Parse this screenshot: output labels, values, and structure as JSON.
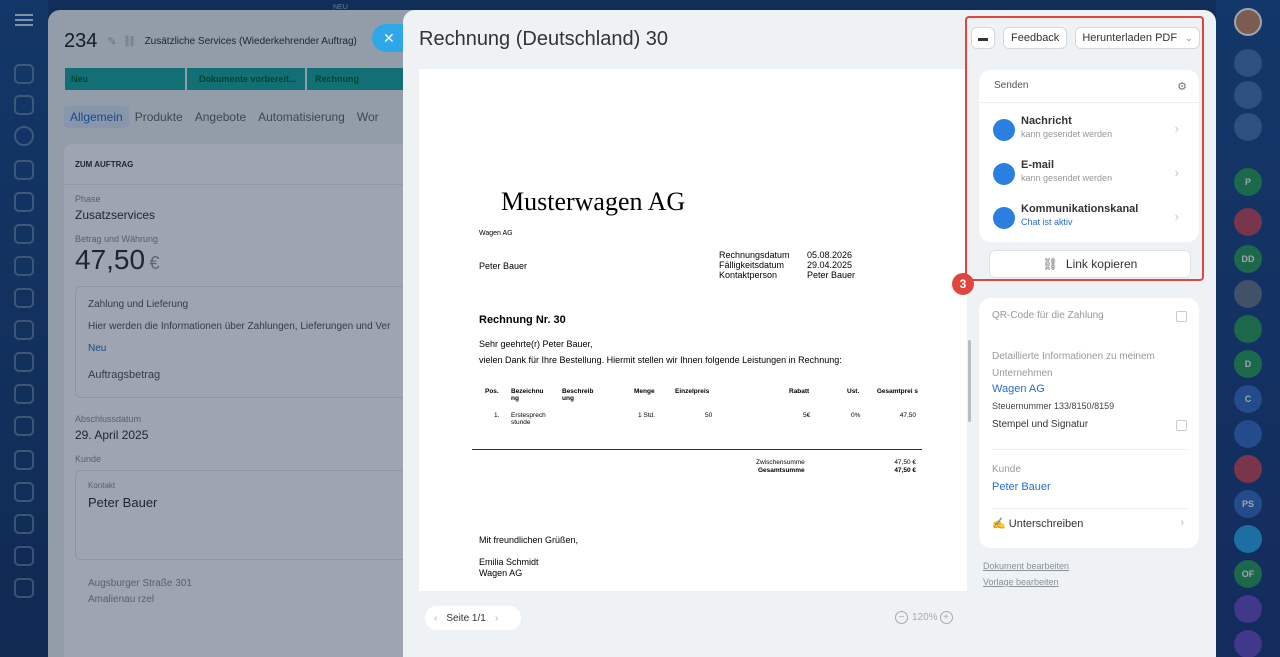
{
  "deal": {
    "id": "234",
    "title": "Zusätzliche Services (Wiederkehrender Auftrag)",
    "stages": [
      "Neu",
      "Dokumente vorbereit...",
      "Rechnung"
    ],
    "tabs": [
      "Allgemein",
      "Produkte",
      "Angebote",
      "Automatisierung",
      "Wor"
    ],
    "section_title": "ZUM AUFTRAG",
    "phase_label": "Phase",
    "phase_value": "Zusatzservices",
    "amount_label": "Betrag und Währung",
    "amount_value": "47,50",
    "currency": "€",
    "payment_title": "Zahlung und Lieferung",
    "payment_text": "Hier werden die Informationen über Zahlungen, Lieferungen und Ver",
    "payment_status": "Neu",
    "order_amount": "Auftragsbetrag",
    "close_label": "Abschlussdatum",
    "close_value": "29. April 2025",
    "client_label": "Kunde",
    "contact_label": "Kontakt",
    "contact_value": "Peter Bauer",
    "address": "Augsburger Straße 301",
    "city": "Amalienau rzel"
  },
  "header": {
    "title": "Rechnung (Deutschland) 30",
    "feedback": "Feedback",
    "download": "Herunterladen PDF"
  },
  "invoice": {
    "company": "Musterwagen AG",
    "company_small": "Wagen AG",
    "customer": "Peter Bauer",
    "meta": [
      {
        "k": "Rechnungsdatum",
        "v": "05.08.2026"
      },
      {
        "k": "Fälligkeitsdatum",
        "v": "29.04.2025"
      },
      {
        "k": "Kontaktperson",
        "v": "Peter Bauer"
      }
    ],
    "number": "Rechnung Nr. 30",
    "greeting": "Sehr geehrte(r) Peter Bauer,",
    "intro": "vielen Dank für Ihre Bestellung. Hiermit stellen wir Ihnen folgende Leistungen in Rechnung:",
    "headers": [
      "Pos.",
      "Bezeichnu ng",
      "Beschreib ung",
      "Menge",
      "Einzelpreis",
      "Rabatt",
      "Ust.",
      "Gesamtprei s"
    ],
    "row": [
      "1.",
      "Erstesprech stunde",
      "",
      "1 Std.",
      "50",
      "5€",
      "0%",
      "47,50"
    ],
    "subtotal_label": "Zwischensumme",
    "subtotal": "47,50 €",
    "total_label": "Gesamtsumme",
    "total": "47,50 €",
    "closing": "Mit freundlichen Grüßen,",
    "signer": "Emilia Schmidt",
    "signer_company": "Wagen AG"
  },
  "pager": {
    "page": "Seite 1/1",
    "zoom": "120%"
  },
  "send": {
    "title": "Senden",
    "items": [
      {
        "title": "Nachricht",
        "sub": "kann gesendet werden"
      },
      {
        "title": "E-mail",
        "sub": "kann gesendet werden"
      },
      {
        "title": "Kommunikationskanal",
        "sub": "Chat ist aktiv"
      }
    ],
    "copy_link": "Link kopieren",
    "step": "3"
  },
  "settings": {
    "qr": "QR-Code für die Zahlung",
    "details": "Detaillierte Informationen zu meinem Unternehmen",
    "company": "Wagen AG",
    "tax": "Steuernummer 133/8150/8159",
    "stamp": "Stempel und Signatur",
    "client_label": "Kunde",
    "client": "Peter Bauer",
    "sign": "Unterschreiben"
  },
  "links": {
    "edit_doc": "Dokument bearbeiten",
    "edit_tpl": "Vorlage bearbeiten"
  },
  "topbar": {
    "badge": "NEU"
  },
  "colors": {
    "accent": "#2a7fe0",
    "highlight": "#e0463d",
    "stage": "#1ca9a1"
  }
}
